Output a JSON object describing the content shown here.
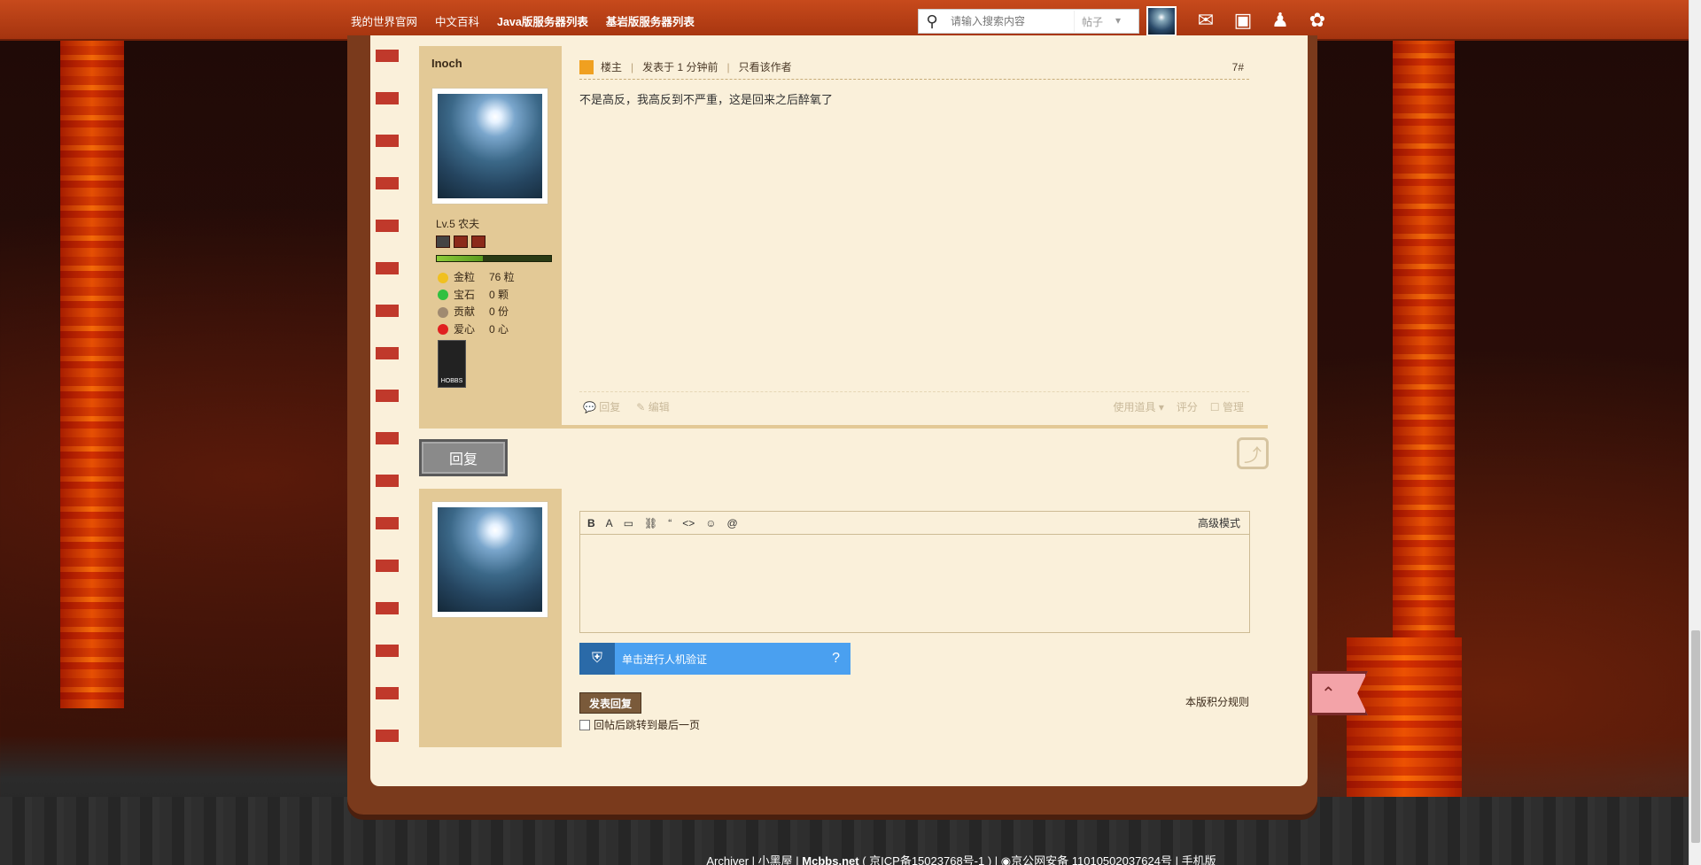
{
  "topbar": {
    "nav": [
      "我的世界官网",
      "中文百科",
      "Java版服务器列表",
      "基岩版服务器列表"
    ],
    "search_placeholder": "请输入搜索内容",
    "search_type": "帖子"
  },
  "post": {
    "author": "Inoch",
    "level": "Lv.5 农夫",
    "stats": [
      {
        "label": "金粒",
        "value": "76 粒",
        "color": "#f0c020"
      },
      {
        "label": "宝石",
        "value": "0 颗",
        "color": "#30c040"
      },
      {
        "label": "贡献",
        "value": "0 份",
        "color": "#a08a70"
      },
      {
        "label": "爱心",
        "value": "0 心",
        "color": "#e02020"
      }
    ],
    "medal_text": "HOBBS",
    "floor_owner": "楼主",
    "posted": "发表于 1 分钟前",
    "only_author": "只看该作者",
    "floor": "7#",
    "content": "不是高反，我高反到不严重，这是回来之后醉氧了",
    "actions_left": [
      "回复",
      "编辑"
    ],
    "actions_right": [
      "使用道具",
      "评分",
      "管理"
    ]
  },
  "reply": {
    "button": "回复",
    "advanced": "高级模式",
    "captcha": "单击进行人机验证",
    "submit": "发表回复",
    "rules": "本版积分规则",
    "jump_last": "回帖后跳转到最后一页"
  },
  "footer": {
    "archiver": "Archiver",
    "mini": "小黑屋",
    "site": "Mcbbs.net",
    "icp": "( 京ICP备15023768号-1 )",
    "police": "京公网安备 11010502037624号",
    "mobile": "手机版"
  }
}
